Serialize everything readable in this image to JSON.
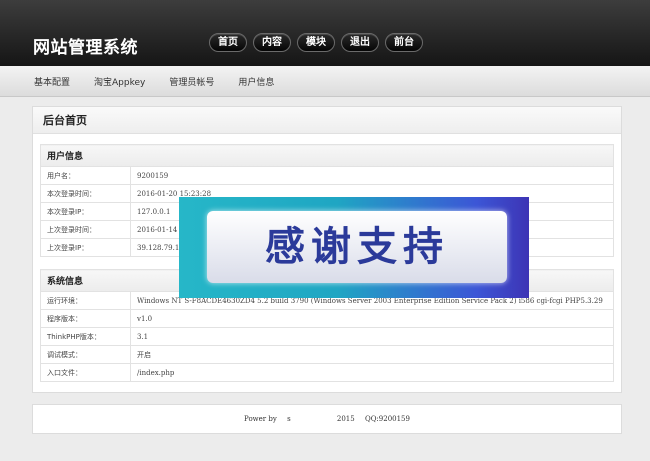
{
  "header": {
    "site_title": "网站管理系统",
    "nav": [
      "首页",
      "内容",
      "模块",
      "退出",
      "前台"
    ]
  },
  "sub_nav": [
    "基本配置",
    "淘宝Appkey",
    "管理员帐号",
    "用户信息"
  ],
  "panel": {
    "title": "后台首页",
    "user_info": {
      "heading": "用户信息",
      "rows": [
        {
          "label": "用户名：",
          "value": "9200159"
        },
        {
          "label": "本次登录时间：",
          "value": "2016-01-20 15:23:28"
        },
        {
          "label": "本次登录IP：",
          "value": "127.0.0.1"
        },
        {
          "label": "上次登录时间：",
          "value": "2016-01-14 2"
        },
        {
          "label": "上次登录IP：",
          "value": "39.128.79.18"
        }
      ]
    },
    "system_info": {
      "heading": "系统信息",
      "rows": [
        {
          "label": "运行环境：",
          "value": "Windows NT S-F8ACDE4630ZD4 5.2 build 3790 (Windows Server 2003 Enterprise Edition Service Pack 2) i586 cgi-fcgi PHP5.3.29"
        },
        {
          "label": "程序版本：",
          "value": "v1.0"
        },
        {
          "label": "ThinkPHP版本：",
          "value": "3.1"
        },
        {
          "label": "调试模式：",
          "value": "开启"
        },
        {
          "label": "入口文件：",
          "value": "/index.php"
        }
      ]
    }
  },
  "footer": {
    "power": "Power by",
    "name": "s",
    "year": "2015",
    "qq": "QQ:9200159"
  },
  "overlay": {
    "text": "感谢支持"
  }
}
